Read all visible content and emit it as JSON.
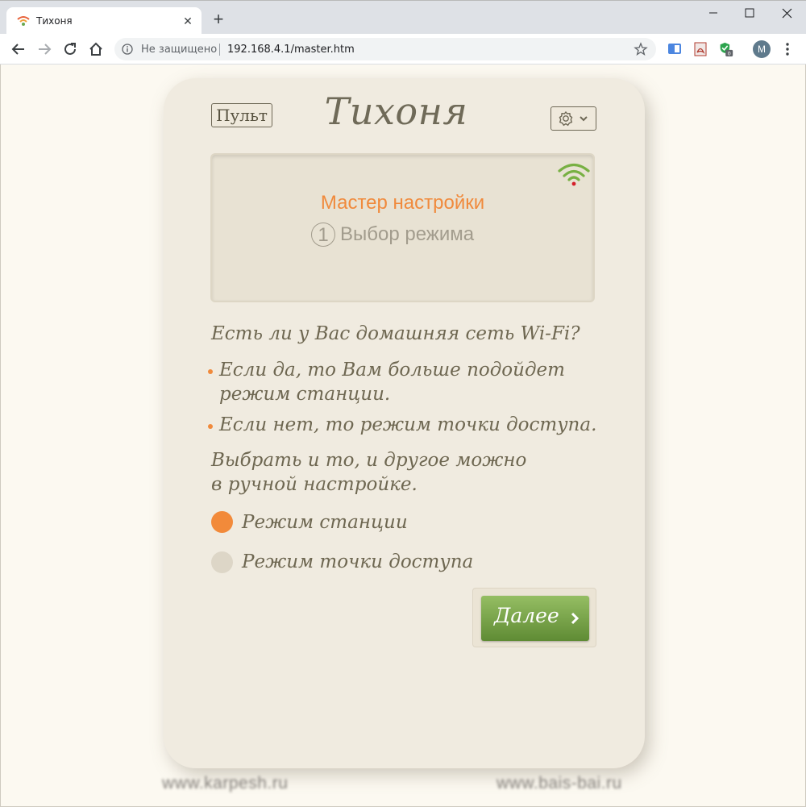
{
  "browser": {
    "tab_title": "Тихоня",
    "address_security": "Не защищено",
    "url": "192.168.4.1/master.htm",
    "profile_initial": "M",
    "ext_badge": "0"
  },
  "app": {
    "pult_label": "Пульт",
    "brand": "Тихоня",
    "display_title": "Мастер настройки",
    "step_number": "1",
    "step_label": "Выбор режима",
    "question": "Есть ли у Вас домашняя сеть Wi-Fi?",
    "bullet1_line1": "Если да, то Вам больше подойдет",
    "bullet1_line2": "режим станции.",
    "bullet2": "Если нет, то режим точки доступа.",
    "manual_line1": "Выбрать и то, и другое можно",
    "manual_line2": "в ручной настройке.",
    "radio_station": "Режим станции",
    "radio_ap": "Режим точки доступа",
    "selected_mode": "Режим станции",
    "next_label": "Далее",
    "accent_color": "#f08a3c",
    "button_color": "#7aa64b"
  },
  "footer": {
    "link_left": "www.karpesh.ru",
    "link_right": "www.bais-bai.ru"
  }
}
